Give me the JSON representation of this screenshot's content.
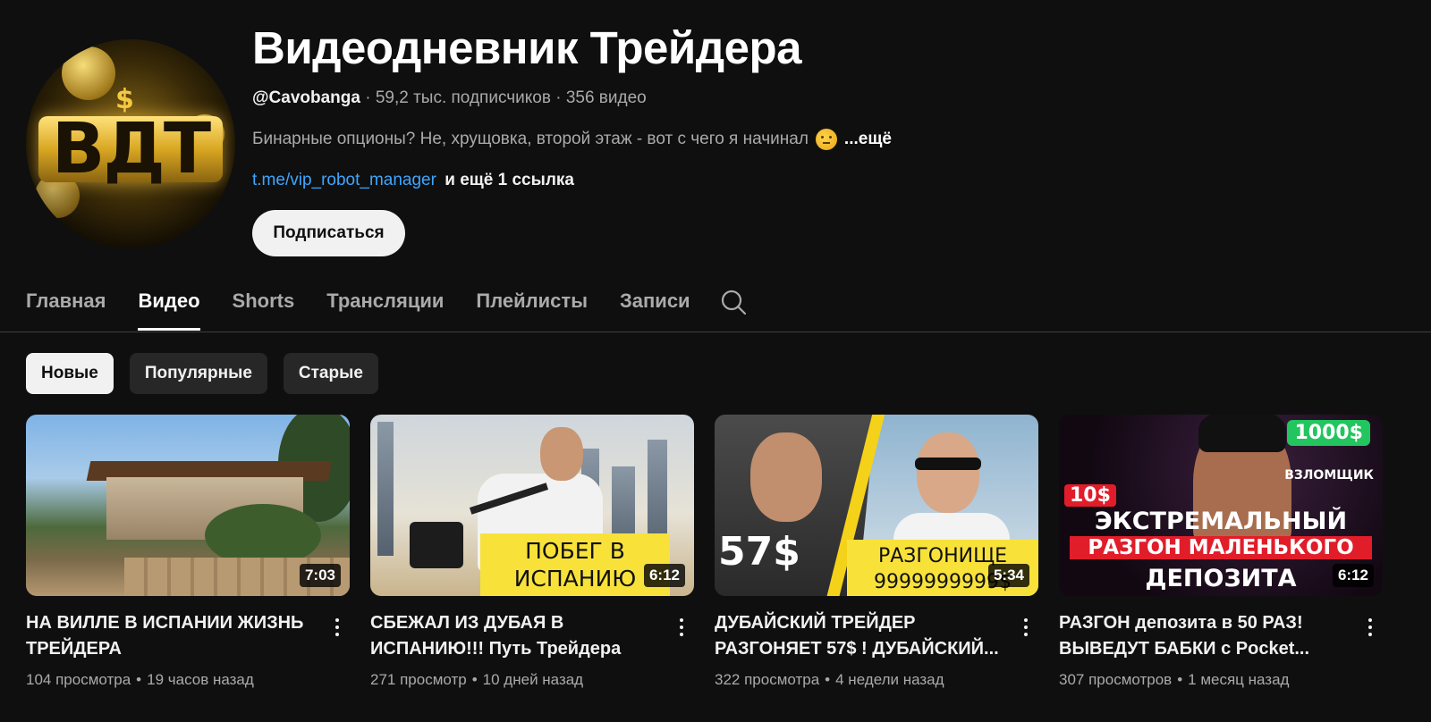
{
  "channel": {
    "title": "Видеодневник Трейдера",
    "handle": "@Cavobanga",
    "subscribers": "59,2 тыс. подписчиков",
    "video_count": "356 видео",
    "separator": "·",
    "description": "Бинарные опционы? Не, хрущовка, второй этаж - вот с чего я начинал",
    "description_emoji": "thinking-face-emoji",
    "more_label": "...ещё",
    "link": "t.me/vip_robot_manager",
    "more_links": "и ещё 1 ссылка",
    "subscribe_label": "Подписаться",
    "avatar_text": "ВДТ"
  },
  "tabs": [
    {
      "label": "Главная",
      "active": false
    },
    {
      "label": "Видео",
      "active": true
    },
    {
      "label": "Shorts",
      "active": false
    },
    {
      "label": "Трансляции",
      "active": false
    },
    {
      "label": "Плейлисты",
      "active": false
    },
    {
      "label": "Записи",
      "active": false
    }
  ],
  "chips": [
    {
      "label": "Новые",
      "selected": true
    },
    {
      "label": "Популярные",
      "selected": false
    },
    {
      "label": "Старые",
      "selected": false
    }
  ],
  "videos": [
    {
      "title": "НА ВИЛЛЕ В ИСПАНИИ ЖИЗНЬ ТРЕЙДЕРА",
      "duration": "7:03",
      "views": "104 просмотра",
      "age": "19 часов назад"
    },
    {
      "title": "СБЕЖАЛ ИЗ ДУБАЯ В ИСПАНИЮ!!! Путь Трейдера",
      "duration": "6:12",
      "views": "271 просмотр",
      "age": "10 дней назад",
      "thumb_text": "ПОБЕГ В ИСПАНИЮ"
    },
    {
      "title": "ДУБАЙСКИЙ ТРЕЙДЕР РАЗГОНЯЕТ 57$ ! ДУБАЙСКИЙ...",
      "duration": "5:34",
      "views": "322 просмотра",
      "age": "4 недели назад",
      "thumb_price": "57$",
      "thumb_text": "РАЗГОНИЩЕ 9999999999$"
    },
    {
      "title": "РАЗГОН депозита в 50 РАЗ! ВЫВЕДУТ БАБКИ с Pocket...",
      "duration": "6:12",
      "views": "307 просмотров",
      "age": "1 месяц назад",
      "thumb_badge_green": "1000$",
      "thumb_badge_red": "10$",
      "thumb_tag": "ВЗЛОМЩИК",
      "thumb_line1": "ЭКСТРЕМАЛЬНЫЙ",
      "thumb_line2": "РАЗГОН МАЛЕНЬКОГО",
      "thumb_line3": "ДЕПОЗИТА"
    }
  ],
  "stats_separator": "•",
  "colors": {
    "background": "#0f0f0f",
    "link": "#3ea6ff",
    "text_secondary": "#aaaaaa"
  }
}
